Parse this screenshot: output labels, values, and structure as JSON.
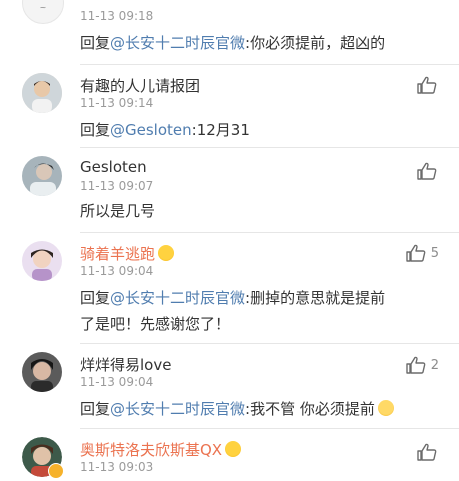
{
  "comments": [
    {
      "name": "",
      "time": "11-13 09:18",
      "reply_prefix": "回复",
      "mention": "@长安十二时辰官微",
      "reply_text": ":你必须提前，超凶的",
      "likes": ""
    },
    {
      "name": "有趣的人儿请报团",
      "time": "11-13 09:14",
      "reply_prefix": "回复",
      "mention": "@Gesloten",
      "reply_text": ":12月31",
      "likes": ""
    },
    {
      "name": "Gesloten",
      "time": "11-13 09:07",
      "text": "所以是几号",
      "likes": ""
    },
    {
      "name": "骑着羊逃跑",
      "time": "11-13 09:04",
      "reply_prefix": "回复",
      "mention": "@长安十二时辰官微",
      "reply_text": ":删掉的意思就是提前",
      "reply_text_2": "了是吧！先感谢您了！",
      "likes": "5"
    },
    {
      "name": "烊烊得易love",
      "time": "11-13 09:04",
      "reply_prefix": "回复",
      "mention": "@长安十二时辰官微",
      "reply_text": ":我不管 你必须提前",
      "likes": "2"
    },
    {
      "name": "奥斯特洛夫欣斯基QX",
      "time": "11-13 09:03",
      "likes": ""
    }
  ],
  "icons": {
    "like": "thumbs-up-icon",
    "emoji": "emoji-icon"
  },
  "colors": {
    "mention": "#507daf",
    "vip_name": "#eb7350",
    "time": "#9a9a9a",
    "divider": "#e6e6e6"
  }
}
